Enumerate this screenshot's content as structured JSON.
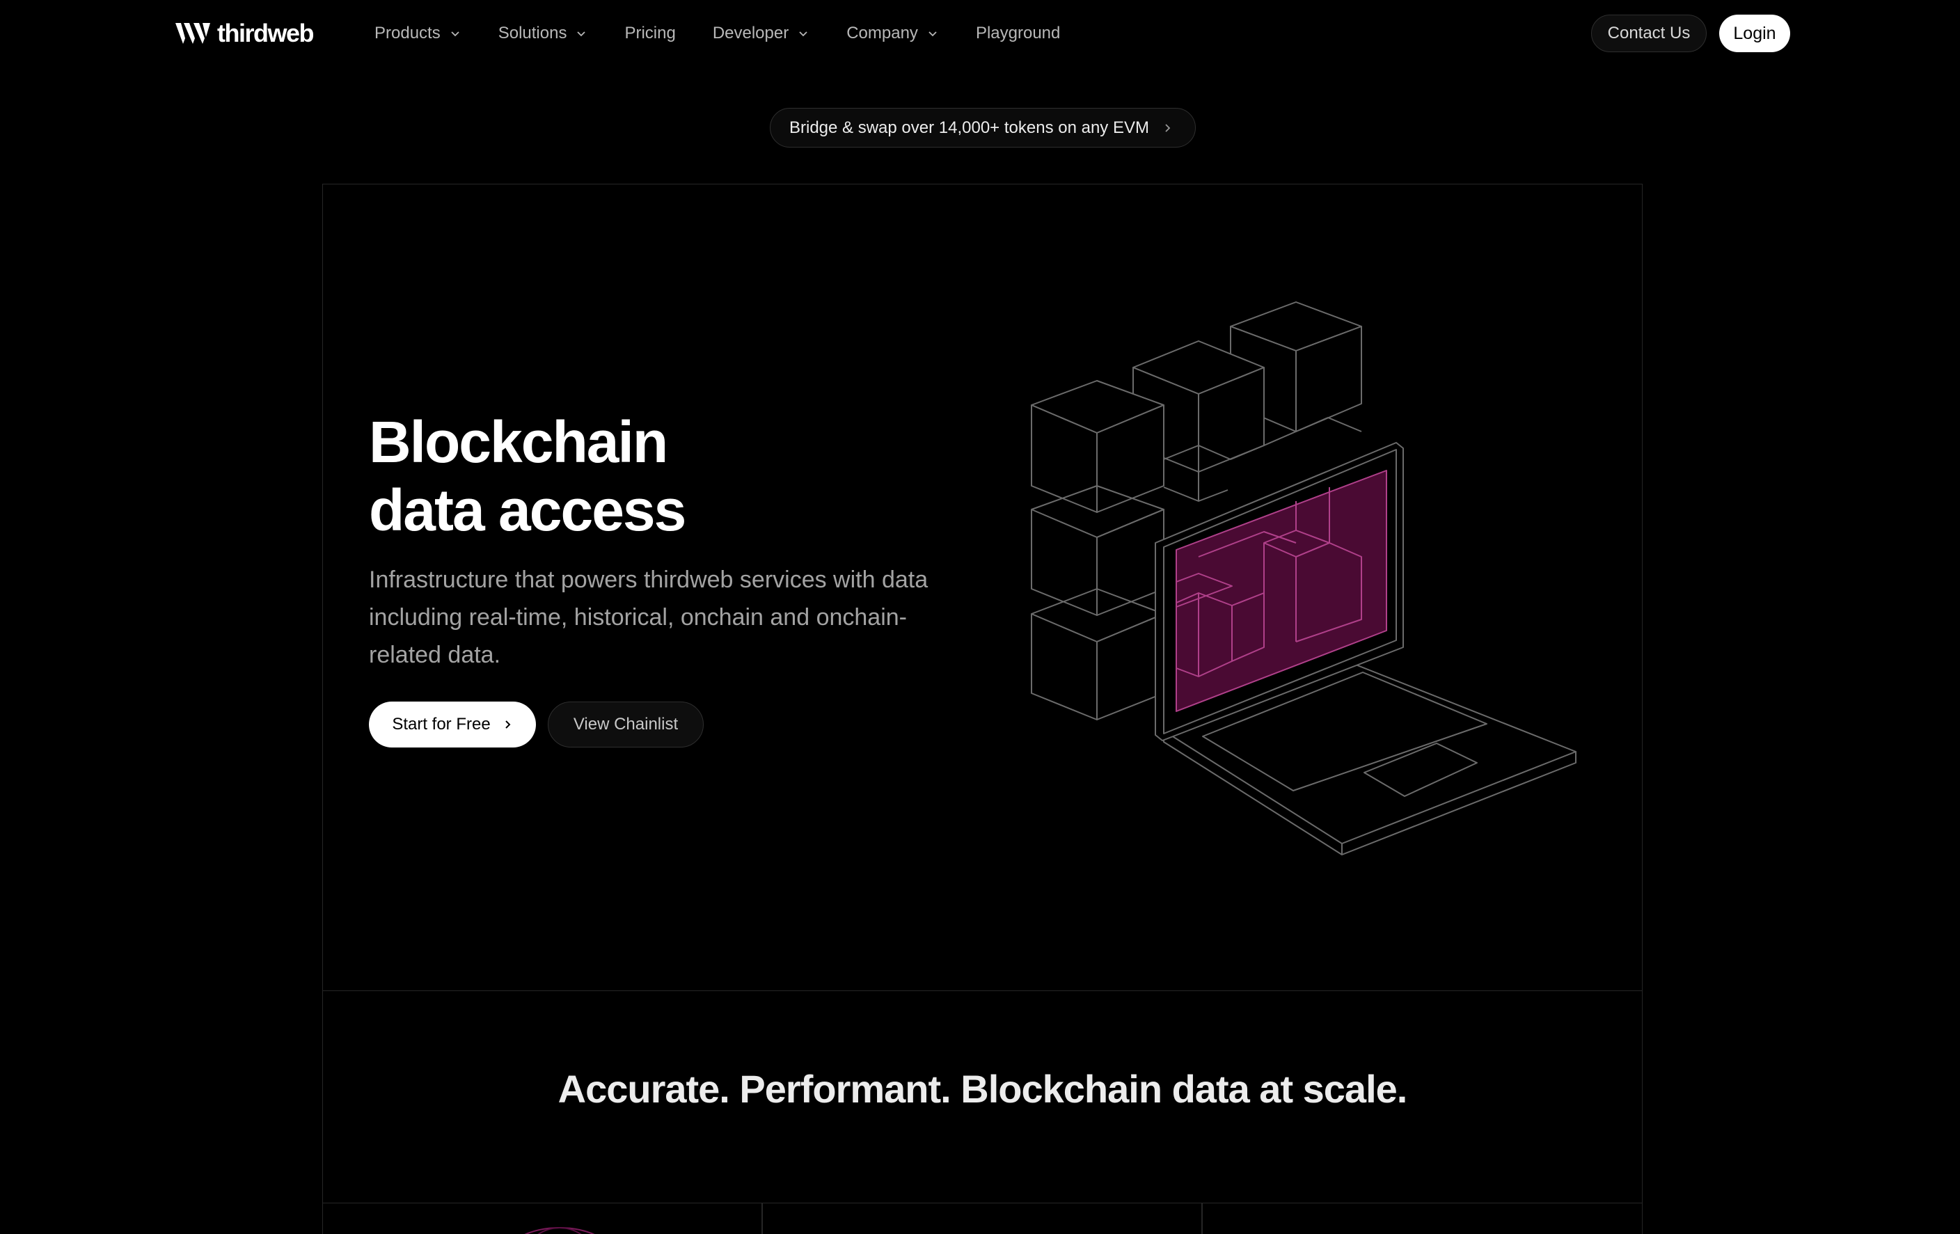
{
  "nav": {
    "logo_text": "thirdweb",
    "items": [
      {
        "label": "Products",
        "has_dropdown": true
      },
      {
        "label": "Solutions",
        "has_dropdown": true
      },
      {
        "label": "Pricing",
        "has_dropdown": false
      },
      {
        "label": "Developer",
        "has_dropdown": true
      },
      {
        "label": "Company",
        "has_dropdown": true
      },
      {
        "label": "Playground",
        "has_dropdown": false
      }
    ],
    "contact_label": "Contact Us",
    "login_label": "Login"
  },
  "announcement": {
    "text": "Bridge & swap over 14,000+ tokens on any EVM"
  },
  "hero": {
    "title_line1": "Blockchain",
    "title_line2": "data access",
    "description": "Infrastructure that powers thirdweb services with data including real-time, historical, onchain and onchain-related data.",
    "primary_cta": "Start for Free",
    "secondary_cta": "View Chainlist"
  },
  "section2": {
    "tagline": "Accurate. Performant. Blockchain data at scale."
  },
  "colors": {
    "background": "#000000",
    "accent_magenta": "#4a0a33",
    "accent_line": "#b0408a"
  },
  "icons": {
    "dropdown": "chevron-down-icon",
    "arrow": "chevron-right-icon"
  }
}
